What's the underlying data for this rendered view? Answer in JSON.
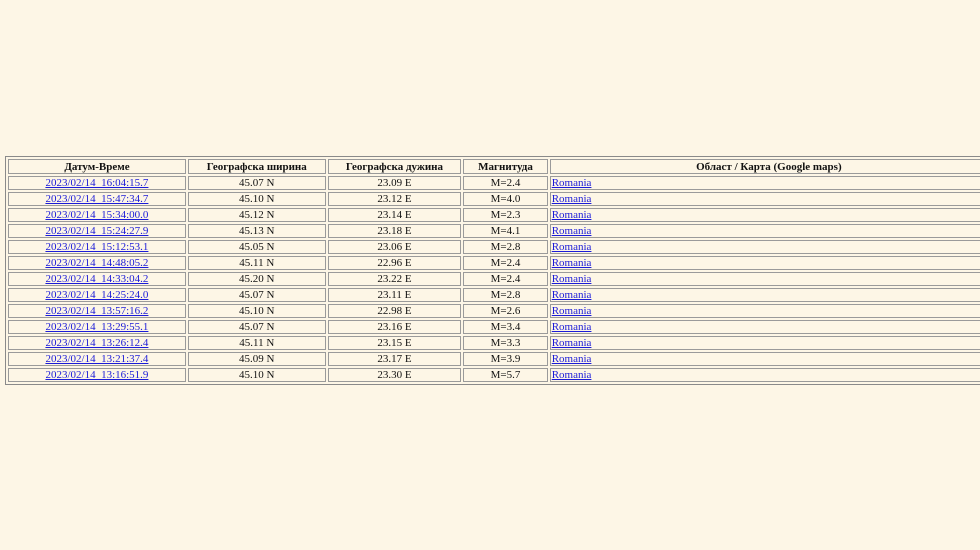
{
  "table": {
    "headers": [
      "Датум-Време",
      "Географска ширина",
      "Географска дужина",
      "Магнитуда",
      "Област / Карта (Google maps)"
    ],
    "rows": [
      {
        "datetime": "2023/02/14_16:04:15.7",
        "lat": "45.07 N",
        "lon": "23.09 E",
        "mag": "M=2.4",
        "region": "Romania"
      },
      {
        "datetime": "2023/02/14_15:47:34.7",
        "lat": "45.10 N",
        "lon": "23.12 E",
        "mag": "M=4.0",
        "region": "Romania"
      },
      {
        "datetime": "2023/02/14_15:34:00.0",
        "lat": "45.12 N",
        "lon": "23.14 E",
        "mag": "M=2.3",
        "region": "Romania"
      },
      {
        "datetime": "2023/02/14_15:24:27.9",
        "lat": "45.13 N",
        "lon": "23.18 E",
        "mag": "M=4.1",
        "region": "Romania"
      },
      {
        "datetime": "2023/02/14_15:12:53.1",
        "lat": "45.05 N",
        "lon": "23.06 E",
        "mag": "M=2.8",
        "region": "Romania"
      },
      {
        "datetime": "2023/02/14_14:48:05.2",
        "lat": "45.11 N",
        "lon": "22.96 E",
        "mag": "M=2.4",
        "region": "Romania"
      },
      {
        "datetime": "2023/02/14_14:33:04.2",
        "lat": "45.20 N",
        "lon": "23.22 E",
        "mag": "M=2.4",
        "region": "Romania"
      },
      {
        "datetime": "2023/02/14_14:25:24.0",
        "lat": "45.07 N",
        "lon": "23.11 E",
        "mag": "M=2.8",
        "region": "Romania"
      },
      {
        "datetime": "2023/02/14_13:57:16.2",
        "lat": "45.10 N",
        "lon": "22.98 E",
        "mag": "M=2.6",
        "region": "Romania"
      },
      {
        "datetime": "2023/02/14_13:29:55.1",
        "lat": "45.07 N",
        "lon": "23.16 E",
        "mag": "M=3.4",
        "region": "Romania"
      },
      {
        "datetime": "2023/02/14_13:26:12.4",
        "lat": "45.11 N",
        "lon": "23.15 E",
        "mag": "M=3.3",
        "region": "Romania"
      },
      {
        "datetime": "2023/02/14_13:21:37.4",
        "lat": "45.09 N",
        "lon": "23.17 E",
        "mag": "M=3.9",
        "region": "Romania"
      },
      {
        "datetime": "2023/02/14_13:16:51.9",
        "lat": "45.10 N",
        "lon": "23.30 E",
        "mag": "M=5.7",
        "region": "Romania"
      }
    ]
  },
  "colors": {
    "background": "#fdf6e6",
    "link": "#1b1bd8"
  }
}
